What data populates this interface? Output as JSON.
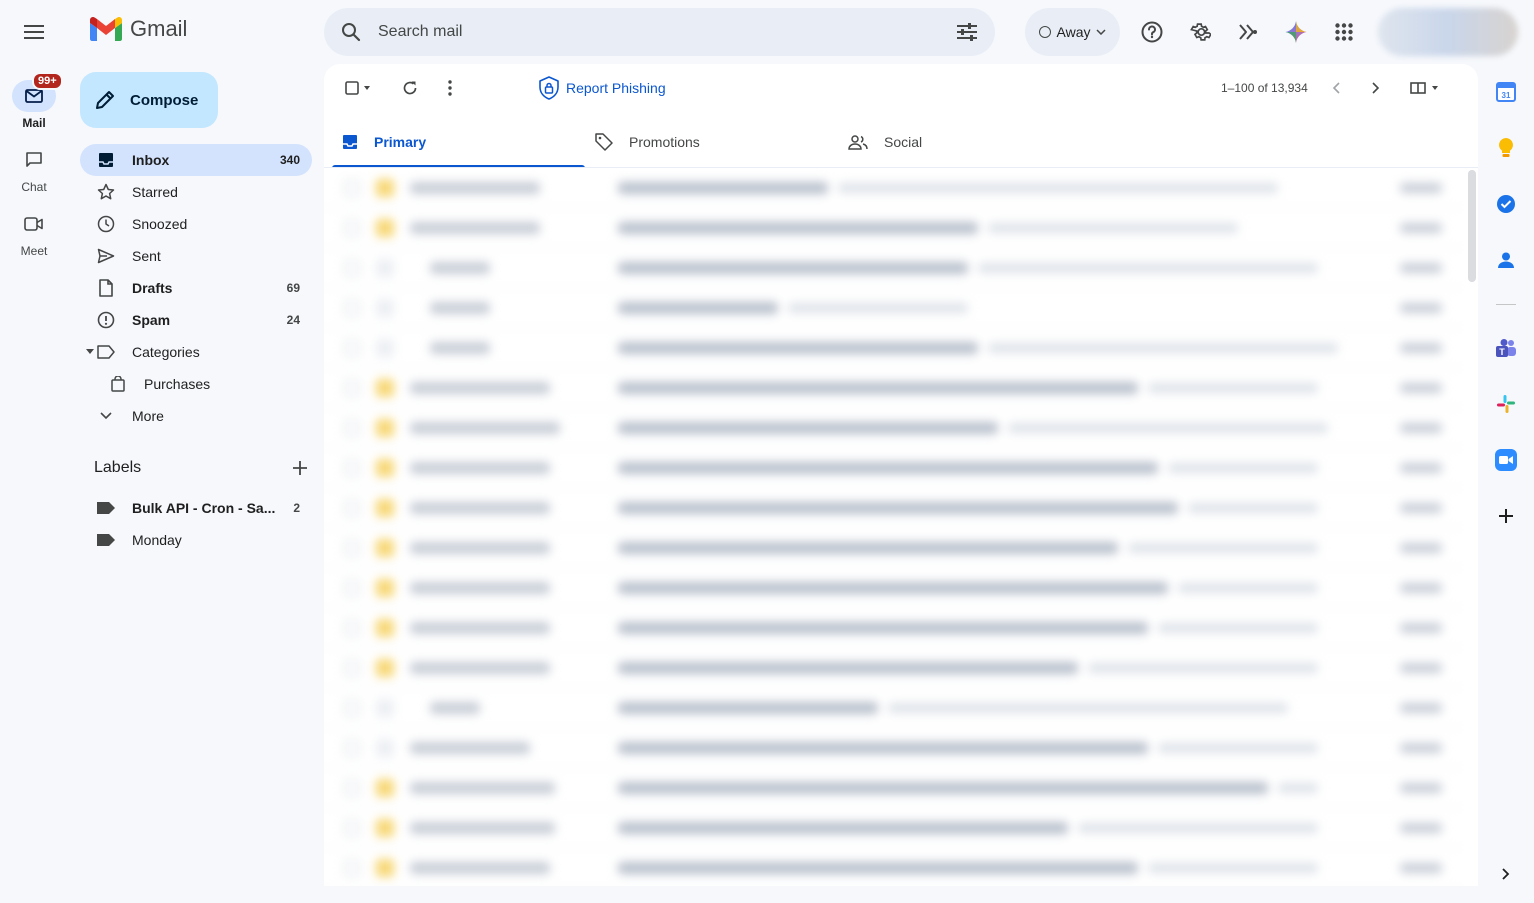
{
  "app": {
    "name": "Gmail"
  },
  "search": {
    "placeholder": "Search mail"
  },
  "status": {
    "label": "Away"
  },
  "rail": {
    "mail": {
      "label": "Mail",
      "badge": "99+"
    },
    "chat": {
      "label": "Chat"
    },
    "meet": {
      "label": "Meet"
    }
  },
  "compose": {
    "label": "Compose"
  },
  "nav": [
    {
      "label": "Inbox",
      "count": "340"
    },
    {
      "label": "Starred",
      "count": ""
    },
    {
      "label": "Snoozed",
      "count": ""
    },
    {
      "label": "Sent",
      "count": ""
    },
    {
      "label": "Drafts",
      "count": "69"
    },
    {
      "label": "Spam",
      "count": "24"
    },
    {
      "label": "Categories",
      "count": ""
    },
    {
      "label": "Purchases",
      "count": ""
    },
    {
      "label": "More",
      "count": ""
    }
  ],
  "labels": {
    "title": "Labels",
    "items": [
      {
        "label": "Bulk API - Cron - Sa...",
        "count": "2"
      },
      {
        "label": "Monday",
        "count": ""
      }
    ]
  },
  "toolbar": {
    "report_phishing": "Report Phishing",
    "pagination": "1–100 of 13,934"
  },
  "tabs": [
    {
      "label": "Primary"
    },
    {
      "label": "Promotions"
    },
    {
      "label": "Social"
    }
  ],
  "colors": {
    "accent": "#0b57d0",
    "compose_bg": "#c2e7ff",
    "active_nav_bg": "#d3e3fd",
    "badge": "#b3261e"
  }
}
